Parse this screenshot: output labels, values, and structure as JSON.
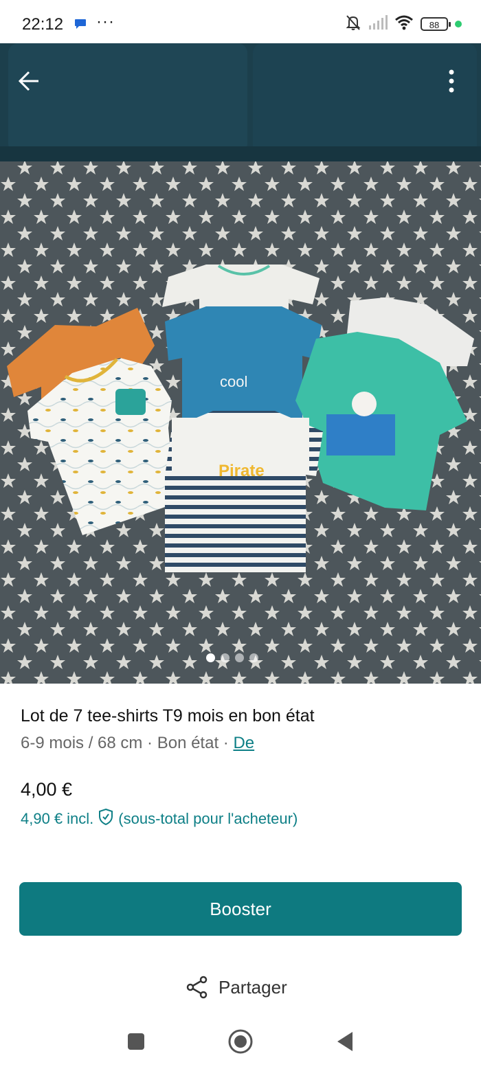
{
  "status_bar": {
    "time": "22:12",
    "dots": "···",
    "battery": "88"
  },
  "photo": {
    "carousel_count": 4,
    "carousel_active_index": 0
  },
  "item": {
    "title": "Lot de 7 tee-shirts T9 mois en bon état",
    "subtitle_text": "6-9 mois / 68 cm · Bon état · ",
    "subtitle_link": "De",
    "price": "4,00 €",
    "buyer_price": "4,90 €",
    "buyer_incl": "incl.",
    "buyer_note": "(sous-total pour l'acheteur)"
  },
  "actions": {
    "booster_label": "Booster",
    "share_label": "Partager"
  },
  "colors": {
    "accent": "#0e7a80",
    "link": "#0d7f86"
  },
  "icons": [
    "arrow-left-icon",
    "more-vertical-icon",
    "shield-check-icon",
    "share-icon",
    "nav-recents-icon",
    "nav-home-icon",
    "nav-back-icon"
  ]
}
